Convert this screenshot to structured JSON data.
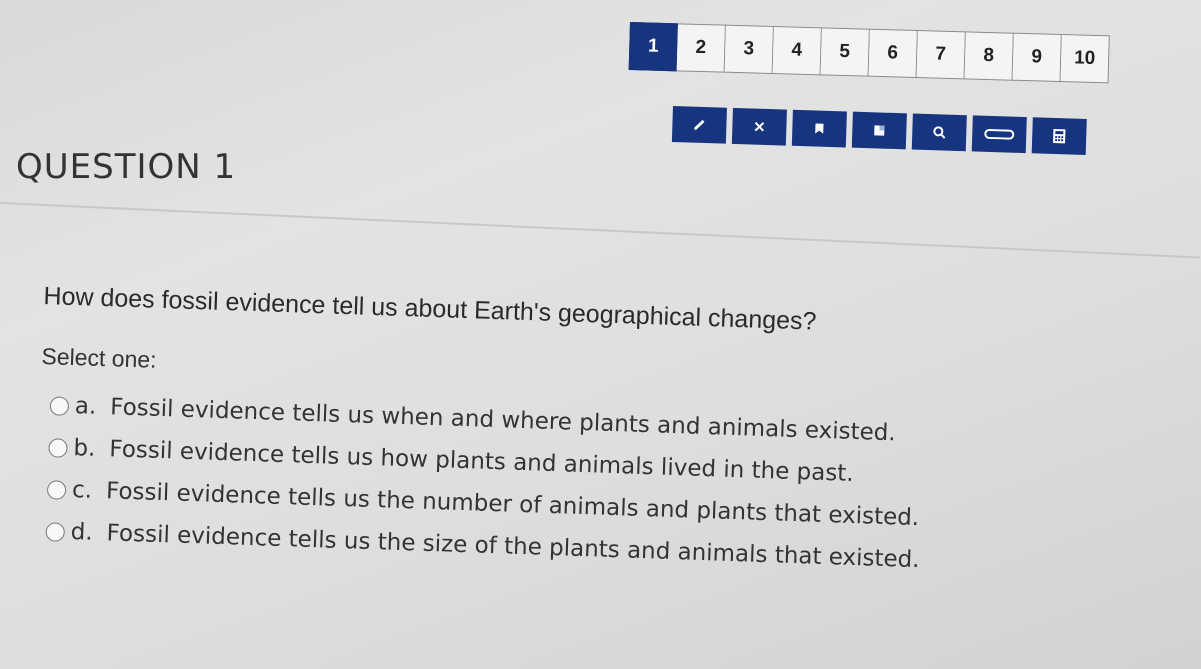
{
  "nav": {
    "questions": [
      "1",
      "2",
      "3",
      "4",
      "5",
      "6",
      "7",
      "8",
      "9",
      "10"
    ],
    "active_index": 0
  },
  "toolbar": {
    "tools": [
      {
        "icon": "pencil-icon",
        "glyph": "✎"
      },
      {
        "icon": "eliminate-icon",
        "glyph": "×"
      },
      {
        "icon": "bookmark-icon",
        "glyph": ""
      },
      {
        "icon": "highlighter-icon",
        "glyph": ""
      },
      {
        "icon": "magnifier-icon",
        "glyph": ""
      },
      {
        "icon": "line-reader-icon",
        "glyph": ""
      },
      {
        "icon": "calculator-icon",
        "glyph": ""
      }
    ],
    "color": "#16357e"
  },
  "question": {
    "title": "QUESTION 1",
    "text": "How does fossil evidence tell us about Earth's geographical changes?",
    "select_label": "Select one:",
    "options": [
      {
        "letter": "a.",
        "text": "Fossil evidence tells us when and where plants and animals existed."
      },
      {
        "letter": "b.",
        "text": "Fossil evidence tells us how plants and animals lived in the past."
      },
      {
        "letter": "c.",
        "text": "Fossil evidence tells us the number of animals and plants that existed."
      },
      {
        "letter": "d.",
        "text": "Fossil evidence tells us the size of the plants and animals that existed."
      }
    ]
  }
}
